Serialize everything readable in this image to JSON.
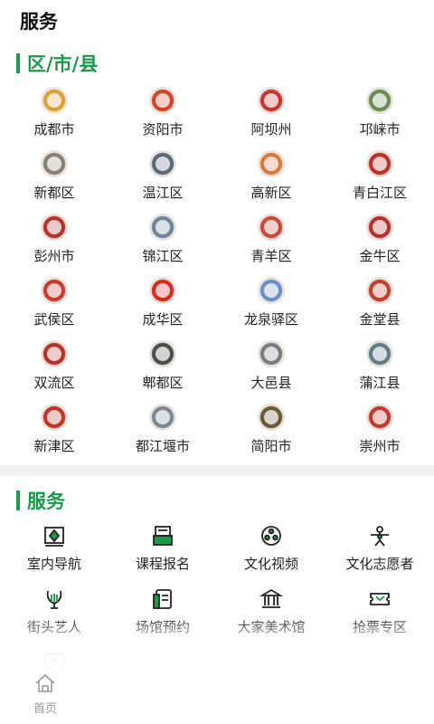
{
  "page_title": "服务",
  "districts": {
    "title": "区/市/县",
    "items": [
      {
        "label": "成都市",
        "color": "#d9a13a"
      },
      {
        "label": "资阳市",
        "color": "#d2452b"
      },
      {
        "label": "阿坝州",
        "color": "#c8342e"
      },
      {
        "label": "邛崃市",
        "color": "#6c8b56"
      },
      {
        "label": "新都区",
        "color": "#8a7f74"
      },
      {
        "label": "温江区",
        "color": "#5a6a78"
      },
      {
        "label": "高新区",
        "color": "#d97a3c"
      },
      {
        "label": "青白江区",
        "color": "#c0302a"
      },
      {
        "label": "彭州市",
        "color": "#b8322c"
      },
      {
        "label": "锦江区",
        "color": "#6f8598"
      },
      {
        "label": "青羊区",
        "color": "#c94a3a"
      },
      {
        "label": "金牛区",
        "color": "#b8302c"
      },
      {
        "label": "武侯区",
        "color": "#c93a30"
      },
      {
        "label": "成华区",
        "color": "#d72b22"
      },
      {
        "label": "龙泉驿区",
        "color": "#6c8ec4"
      },
      {
        "label": "金堂县",
        "color": "#c1402f"
      },
      {
        "label": "双流区",
        "color": "#b8302a"
      },
      {
        "label": "郫都区",
        "color": "#4e4e4e"
      },
      {
        "label": "大邑县",
        "color": "#7a7d80"
      },
      {
        "label": "蒲江县",
        "color": "#5f7c88"
      },
      {
        "label": "新津区",
        "color": "#c23428"
      },
      {
        "label": "都江堰市",
        "color": "#7b8891"
      },
      {
        "label": "简阳市",
        "color": "#6a5a3a"
      },
      {
        "label": "崇州市",
        "color": "#c23a2e"
      }
    ]
  },
  "services": {
    "title": "服务",
    "items": [
      {
        "label": "室内导航",
        "icon": "map-navigation-icon"
      },
      {
        "label": "课程报名",
        "icon": "course-signup-icon"
      },
      {
        "label": "文化视频",
        "icon": "film-reel-icon"
      },
      {
        "label": "文化志愿者",
        "icon": "volunteer-icon"
      },
      {
        "label": "街头艺人",
        "icon": "lyre-icon"
      },
      {
        "label": "场馆预约",
        "icon": "venue-booking-icon"
      },
      {
        "label": "大家美术馆",
        "icon": "museum-icon"
      },
      {
        "label": "抢票专区",
        "icon": "ticket-icon"
      },
      {
        "label": "",
        "icon": "play-icon"
      }
    ]
  },
  "tabbar": {
    "home_label": "首页"
  },
  "colors": {
    "accent": "#1a9b4a",
    "icon": "#222222"
  }
}
